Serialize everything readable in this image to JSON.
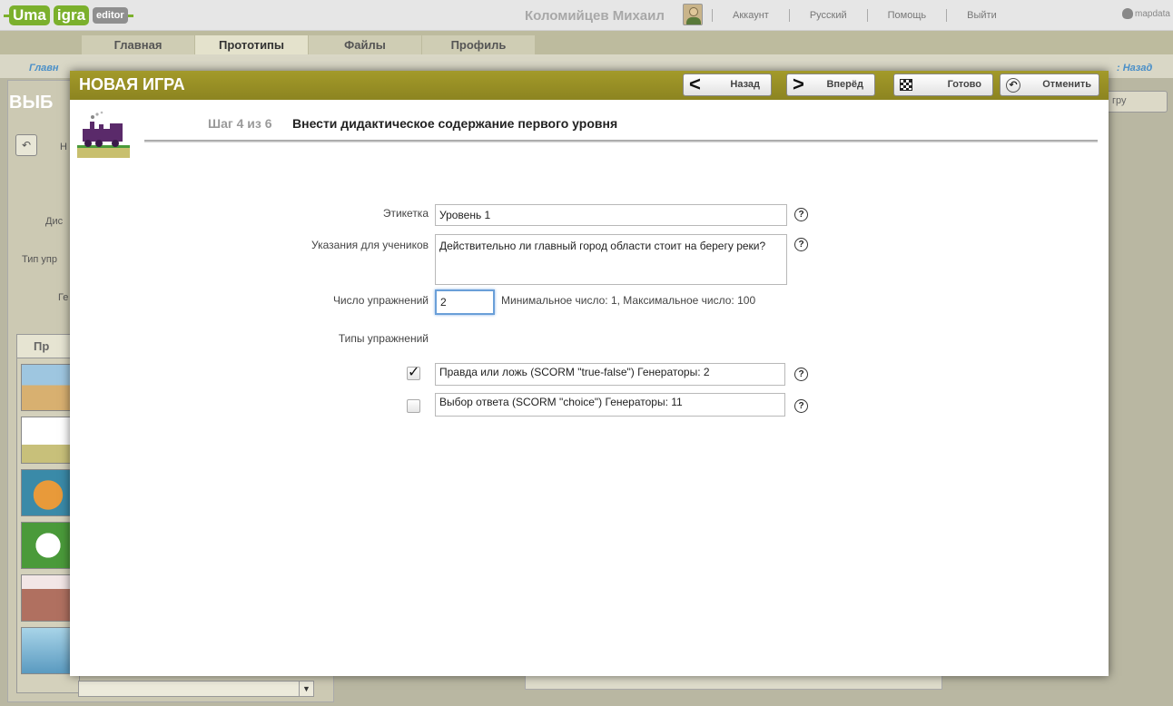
{
  "header": {
    "logo_part1": "Uma",
    "logo_part2": "igra",
    "logo_part3": "editor",
    "user_name": "Коломийцев Михаил",
    "links": [
      "Аккаунт",
      "Русский",
      "Помощь",
      "Выйти"
    ],
    "brand": "mapdata"
  },
  "nav": {
    "tabs": [
      "Главная",
      "Прототипы",
      "Файлы",
      "Профиль"
    ],
    "active": "Прототипы"
  },
  "background": {
    "crumb_left": "Главн",
    "crumb_right": ": Назад",
    "title": "ВЫБ",
    "label_h": "Н",
    "label_dis": "Дис",
    "label_type": "Тип упр",
    "label_ge": "Ге",
    "tab_label": "Пр",
    "right_button": "гру"
  },
  "modal": {
    "title": "НОВАЯ ИГРА",
    "buttons": {
      "back": "Назад",
      "forward": "Вперёд",
      "done": "Готово",
      "cancel": "Отменить"
    },
    "step_label": "Шаг 4 из 6",
    "step_title": "Внести дидактическое содержание первого уровня",
    "form": {
      "label_label": "Этикетка",
      "label_value": "Уровень 1",
      "instructions_label": "Указания для учеников",
      "instructions_value": "Действительно ли главный город области стоит на берегу реки?",
      "count_label": "Число упражнений",
      "count_value": "2",
      "count_hint": "Минимальное число: 1,  Максимальное число: 100",
      "types_label": "Типы упражнений",
      "types": [
        {
          "text": "Правда или ложь (SCORM \"true-false\")  Генераторы: 2",
          "checked": true
        },
        {
          "text": "Выбор ответа (SCORM \"choice\")  Генераторы: 11",
          "checked": false
        }
      ],
      "help_glyph": "?"
    }
  },
  "icons": {
    "back": "chevron-left-icon",
    "forward": "chevron-right-icon",
    "done": "checkered-flag-icon",
    "cancel": "undo-icon",
    "help": "help-icon"
  }
}
